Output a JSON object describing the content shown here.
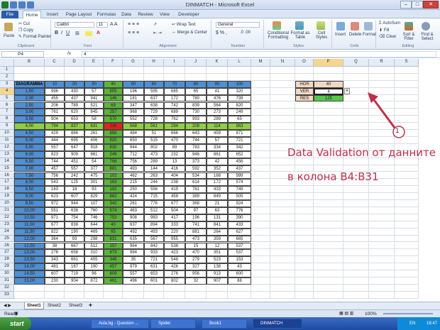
{
  "window": {
    "title": "DINMATCH - Microsoft Excel",
    "min": "–",
    "max": "□",
    "close": "✕"
  },
  "tabs": [
    "File",
    "Home",
    "Insert",
    "Page Layout",
    "Formulas",
    "Data",
    "Review",
    "View",
    "Developer"
  ],
  "ribbon": {
    "paste": "Paste",
    "cut": "Cut",
    "copy": "Copy",
    "format_painter": "Format Painter",
    "clipboard": "Clipboard",
    "font_name": "Calibri",
    "font_size": "11",
    "font": "Font",
    "wrap_text": "Wrap Text",
    "merge_center": "Merge & Center",
    "alignment": "Alignment",
    "number_format": "General",
    "number": "Number",
    "conditional": "Conditional Formatting",
    "format_table": "Format as Table",
    "cell_styles": "Cell Styles",
    "styles": "Styles",
    "insert": "Insert",
    "delete": "Delete",
    "format": "Format",
    "cells": "Cells",
    "autosum": "AutoSum",
    "fill": "Fill",
    "clear": "Clear",
    "sort_filter": "Sort & Filter",
    "find_select": "Find & Select",
    "editing": "Editing"
  },
  "formula_bar": {
    "name_box": "P4",
    "fx": "fx",
    "value": "4"
  },
  "columns": [
    "B",
    "C",
    "D",
    "E",
    "F",
    "G",
    "H",
    "I",
    "J",
    "K",
    "L",
    "M",
    "N",
    "O",
    "P",
    "Q",
    "R",
    "S"
  ],
  "rows": [
    "1",
    "2",
    "3",
    "4",
    "5",
    "6",
    "7",
    "8",
    "9",
    "10",
    "11",
    "12",
    "13",
    "14",
    "15",
    "16",
    "17",
    "18",
    "19",
    "20",
    "21",
    "22",
    "23",
    "24",
    "25",
    "26",
    "27",
    "28",
    "29",
    "30",
    "31",
    "32",
    "33"
  ],
  "table": {
    "title": "DIAGRAMMA",
    "headers": [
      "10",
      "20",
      "30",
      "40",
      "50",
      "60",
      "70",
      "80",
      "90",
      "100"
    ],
    "row_labels": [
      "1,50",
      "2,00",
      "2,50",
      "3,00",
      "3,50",
      "4,00",
      "4,50",
      "5,00",
      "5,50",
      "6,00",
      "6,50",
      "7,00",
      "7,50",
      "8,00",
      "8,50",
      "9,00",
      "9,50",
      "10,00",
      "10,50",
      "11,00",
      "11,50",
      "12,00",
      "12,50",
      "13,00",
      "13,50",
      "14,00",
      "14,50",
      "15,00"
    ],
    "values": [
      [
        "996",
        "430",
        "57",
        "805",
        "196",
        "595",
        "685",
        "65",
        "41",
        "320"
      ],
      [
        "455",
        "437",
        "941",
        "146",
        "181",
        "637",
        "172",
        "780",
        "476",
        "739"
      ],
      [
        "206",
        "789",
        "521",
        "69",
        "347",
        "638",
        "742",
        "839",
        "564",
        "820"
      ],
      [
        "761",
        "620",
        "845",
        "257",
        "968",
        "729",
        "689",
        "730",
        "273",
        "249"
      ],
      [
        "904",
        "653",
        "58",
        "570",
        "552",
        "728",
        "762",
        "993",
        "289",
        "65"
      ],
      [
        "794",
        "837",
        "631",
        "126",
        "568",
        "561",
        "294",
        "208",
        "114",
        "963"
      ],
      [
        "429",
        "886",
        "261",
        "856",
        "484",
        "51",
        "666",
        "643",
        "459",
        "871"
      ],
      [
        "444",
        "695",
        "406",
        "920",
        "650",
        "515",
        "470",
        "744",
        "57",
        "721"
      ],
      [
        "557",
        "647",
        "918",
        "630",
        "944",
        "802",
        "89",
        "783",
        "334",
        "342"
      ],
      [
        "823",
        "909",
        "861",
        "249",
        "712",
        "473",
        "232",
        "946",
        "861",
        "652"
      ],
      [
        "744",
        "451",
        "54",
        "766",
        "756",
        "289",
        "13",
        "373",
        "42",
        "456"
      ],
      [
        "457",
        "557",
        "377",
        "881",
        "493",
        "144",
        "416",
        "592",
        "352",
        "437"
      ],
      [
        "756",
        "242",
        "475",
        "102",
        "462",
        "263",
        "404",
        "534",
        "168",
        "999"
      ],
      [
        "543",
        "125",
        "301",
        "163",
        "215",
        "244",
        "238",
        "614",
        "172",
        "574"
      ],
      [
        "163",
        "18",
        "93",
        "102",
        "250",
        "556",
        "419",
        "761",
        "433",
        "749"
      ],
      [
        "623",
        "607",
        "829",
        "862",
        "424",
        "715",
        "458",
        "389",
        "849",
        "505"
      ],
      [
        "972",
        "944",
        "107",
        "342",
        "261",
        "776",
        "677",
        "368",
        "21",
        "924"
      ],
      [
        "551",
        "638",
        "760",
        "574",
        "463",
        "512",
        "504",
        "97",
        "63",
        "776"
      ],
      [
        "971",
        "754",
        "746",
        "753",
        "908",
        "983",
        "417",
        "196",
        "131",
        "390"
      ],
      [
        "677",
        "838",
        "644",
        "40",
        "637",
        "894",
        "333",
        "741",
        "841",
        "433"
      ],
      [
        "822",
        "190",
        "469",
        "65",
        "492",
        "493",
        "220",
        "881",
        "264",
        "627"
      ],
      [
        "364",
        "93",
        "298",
        "831",
        "635",
        "567",
        "955",
        "473",
        "359",
        "665"
      ],
      [
        "38",
        "667",
        "512",
        "157",
        "964",
        "842",
        "538",
        "15",
        "12",
        "537"
      ],
      [
        "276",
        "658",
        "310",
        "873",
        "984",
        "933",
        "423",
        "470",
        "351",
        "537"
      ],
      [
        "343",
        "661",
        "455",
        "349",
        "35",
        "721",
        "548",
        "279",
        "523",
        "153"
      ],
      [
        "481",
        "167",
        "190",
        "457",
        "979",
        "631",
        "426",
        "327",
        "138",
        "43"
      ],
      [
        "607",
        "719",
        "96",
        "809",
        "557",
        "653",
        "276",
        "956",
        "913",
        "600"
      ],
      [
        "230",
        "904",
        "872",
        "461",
        "496",
        "601",
        "802",
        "32",
        "907",
        "88"
      ]
    ]
  },
  "lookup": {
    "hor_label": "HOR",
    "hor_value": "40",
    "ver_label": "VER",
    "ver_value": "4",
    "res_label": "RES",
    "res_value": "125"
  },
  "annotation": {
    "badge": "1",
    "line1": "Data Validation от данните",
    "line2": "в колона В4:В31"
  },
  "sheets": [
    "Sheet1",
    "Sheet2",
    "Sheet3"
  ],
  "status": {
    "ready": "Ready",
    "zoom": "100%"
  },
  "taskbar": {
    "start": "start",
    "items": [
      "Aula.bg - Question ...",
      "Spider",
      "Book1",
      "DINMATCH"
    ],
    "lang": "EN",
    "time": "18:47"
  },
  "colors": {
    "header_blue": "#4f8fd4",
    "col_green": "#5cb43a",
    "row_green": "#8ece45",
    "red": "#e2231a",
    "res_green": "#53c84a",
    "lookup_tan": "#f2d8c3",
    "annot": "#c0304a"
  }
}
